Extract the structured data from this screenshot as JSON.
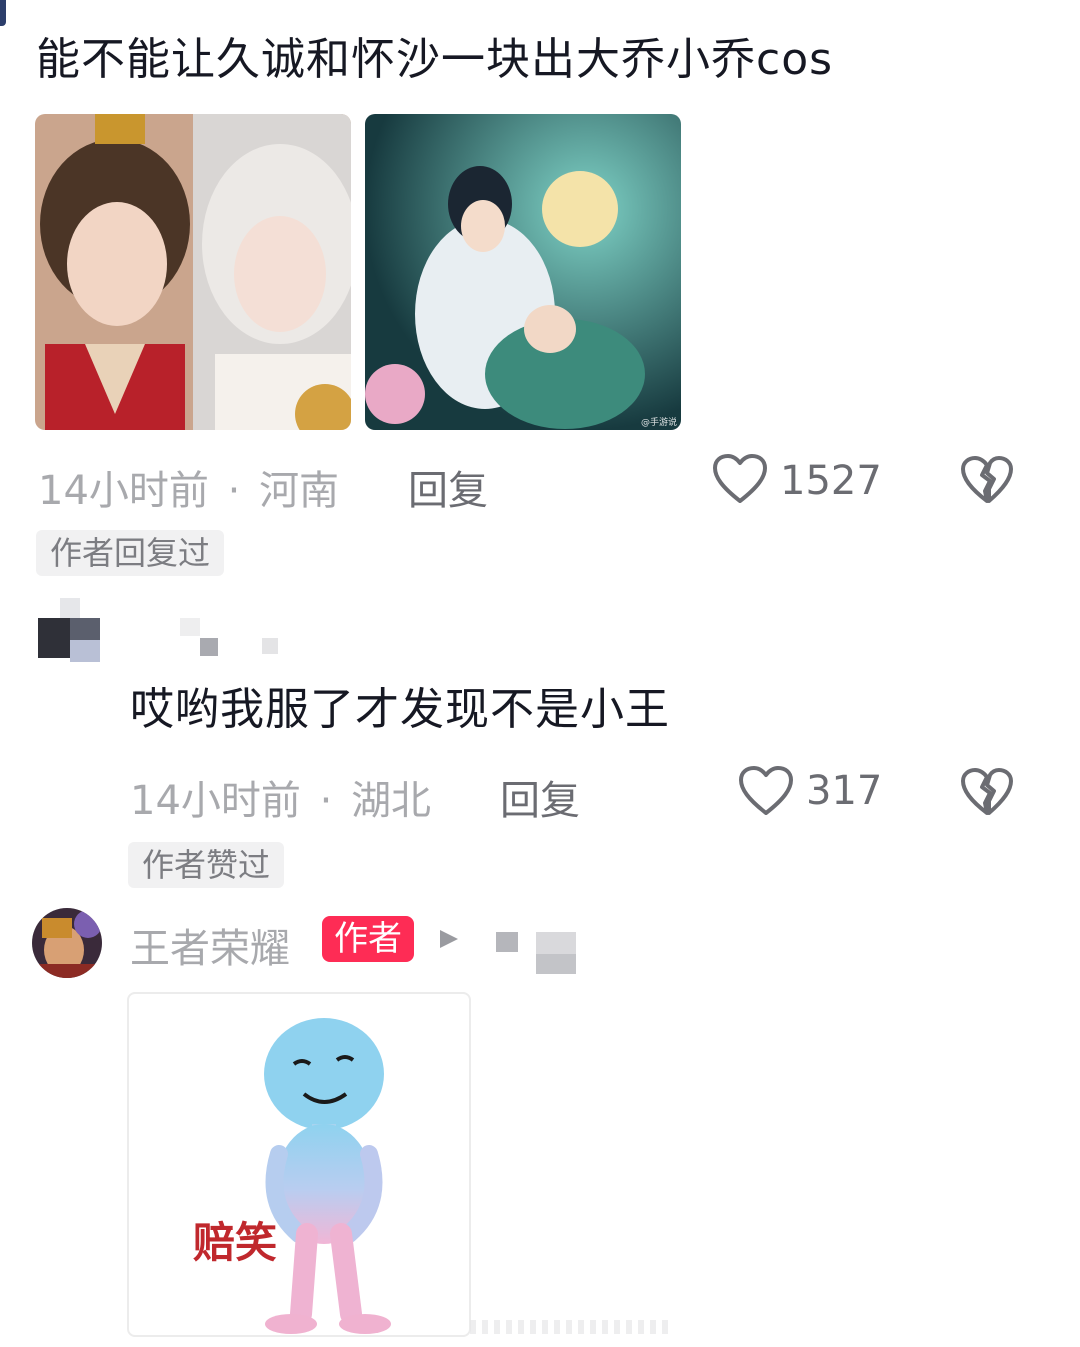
{
  "comment1": {
    "text": "能不能让久诚和怀沙一块出大乔小乔cos",
    "images": [
      {
        "icon": "cosplay-photo"
      },
      {
        "icon": "game-artwork-photo",
        "watermark": "@手游说"
      }
    ],
    "time": "14小时前",
    "location": "河南",
    "separator": "·",
    "reply_label": "回复",
    "like_count": "1527",
    "tag": "作者回复过"
  },
  "comment2": {
    "text": "哎哟我服了才发现不是小王",
    "time": "14小时前",
    "location": "湖北",
    "separator": "·",
    "reply_label": "回复",
    "like_count": "317",
    "tag": "作者赞过"
  },
  "comment3": {
    "author": "王者荣耀",
    "author_badge": "作者",
    "sticker_caption": "赔笑"
  },
  "colors": {
    "accent": "#fe2c55",
    "meta_gray": "#a8a9ad",
    "text": "#161823"
  }
}
